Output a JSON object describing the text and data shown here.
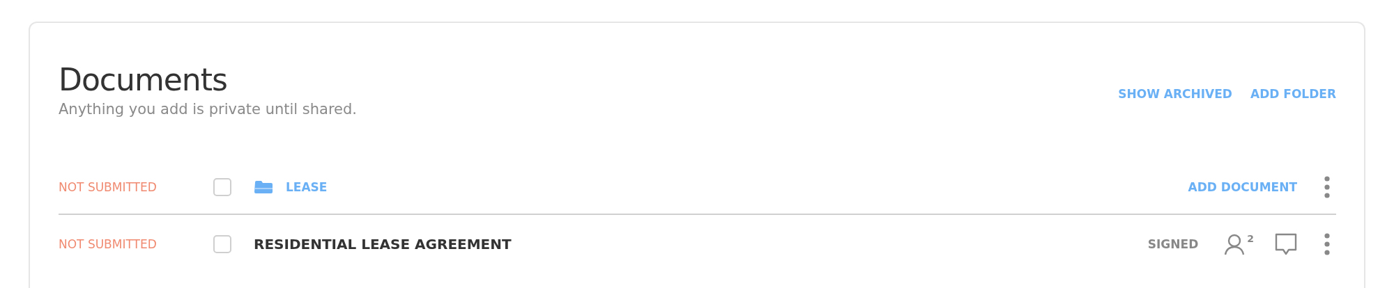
{
  "header": {
    "title": "Documents",
    "subtitle": "Anything you add is private until shared.",
    "actions": [
      "SHOW ARCHIVED",
      "ADD FOLDER"
    ]
  },
  "rows": [
    {
      "kind": "folder",
      "status": "NOT SUBMITTED",
      "checked": false,
      "name": "LEASE",
      "action": "ADD DOCUMENT"
    },
    {
      "kind": "document",
      "status": "NOT SUBMITTED",
      "checked": false,
      "name": "RESIDENTIAL LEASE AGREEMENT",
      "signature": "SIGNED",
      "shared_count": "2"
    }
  ]
}
